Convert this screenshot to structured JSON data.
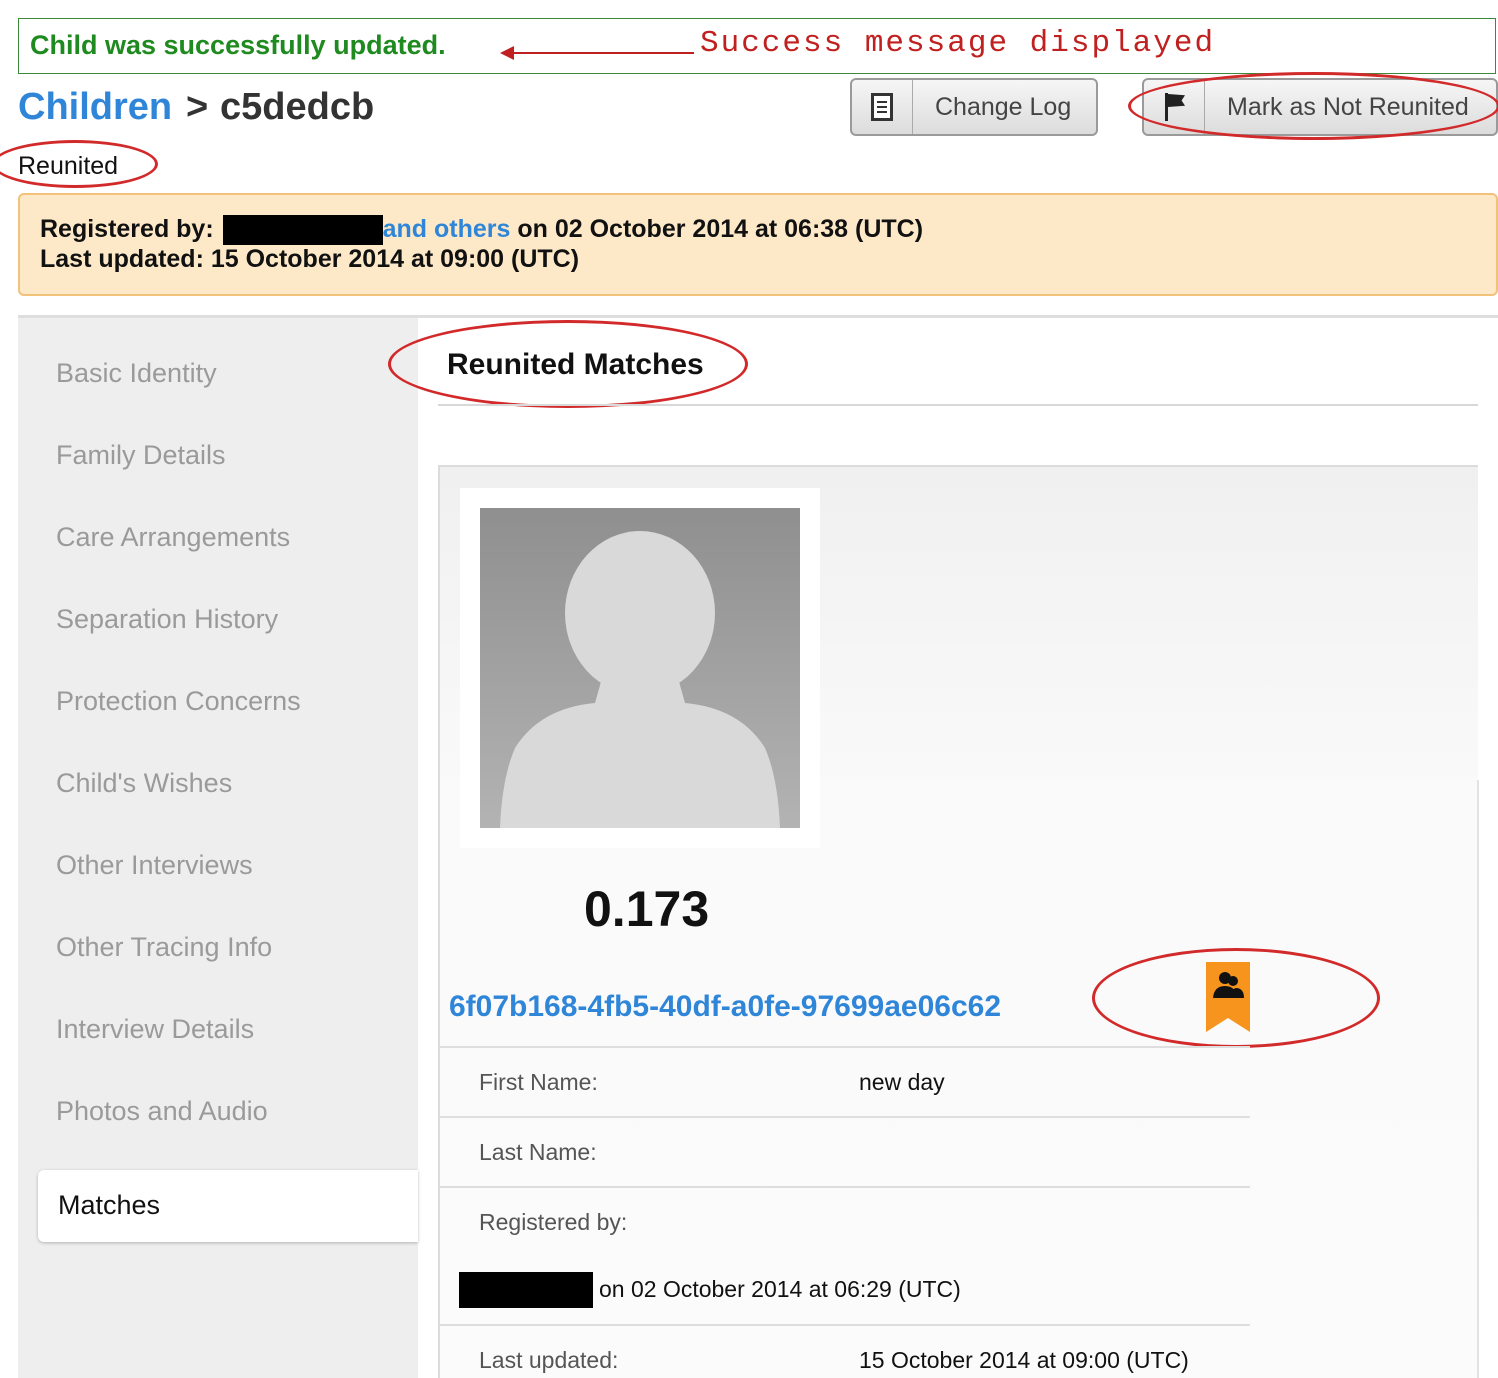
{
  "flash": {
    "message": "Child was successfully updated.",
    "annotation": "Success message displayed"
  },
  "header": {
    "breadcrumb_link": "Children",
    "breadcrumb_separator": ">",
    "record_id": "c5dedcb",
    "status": "Reunited"
  },
  "toolbar": {
    "change_log_label": "Change Log",
    "change_log_icon": "list-icon",
    "mark_not_reunited_label": "Mark as Not Reunited",
    "mark_not_reunited_icon": "flag-icon"
  },
  "record_info": {
    "registered_by_label": "Registered by:",
    "and_others_link": "and others",
    "registered_on": "on 02 October 2014 at 06:38 (UTC)",
    "last_updated_label": "Last updated:",
    "last_updated_value": "15 October 2014 at 09:00 (UTC)"
  },
  "sidebar": {
    "items": [
      "Basic Identity",
      "Family Details",
      "Care Arrangements",
      "Separation History",
      "Protection Concerns",
      "Child's Wishes",
      "Other Interviews",
      "Other Tracing Info",
      "Interview Details",
      "Photos and Audio"
    ],
    "active_item": "Matches"
  },
  "main": {
    "section_title": "Reunited Matches",
    "match": {
      "score": "0.173",
      "id": "6f07b168-4fb5-40df-a0fe-97699ae06c62",
      "reunited_icon": "reunited-ribbon-icon",
      "fields": {
        "first_name_label": "First Name:",
        "first_name_value": "new day",
        "last_name_label": "Last Name:",
        "last_name_value": "",
        "registered_by_label": "Registered by:",
        "registered_on": "on 02 October 2014 at 06:29 (UTC)",
        "last_updated_label": "Last updated:",
        "last_updated_value": "15 October 2014 at 09:00 (UTC)"
      }
    }
  },
  "colors": {
    "link": "#2f86d8",
    "success": "#1f8a1f",
    "annotation": "#c0201f",
    "info_bg": "#fde9c8",
    "ribbon": "#f7941d"
  }
}
